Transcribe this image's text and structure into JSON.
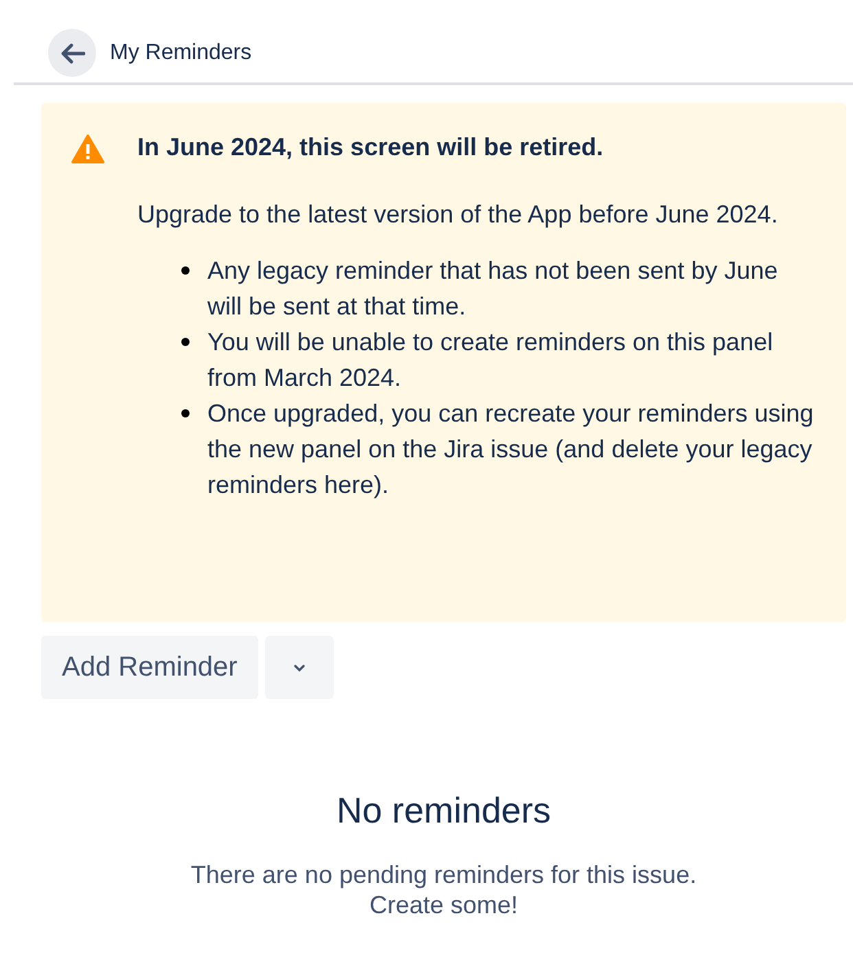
{
  "header": {
    "title": "My Reminders"
  },
  "banner": {
    "title": "In June 2024, this screen will be retired.",
    "message": "Upgrade to the latest version of the App before June 2024.",
    "bullets": [
      "Any legacy reminder that has not been sent by June will be sent at that time.",
      "You will be unable to create reminders on this panel from March 2024.",
      "Once upgraded, you can recreate your reminders using the new panel on the Jira issue (and delete your legacy reminders here)."
    ]
  },
  "actions": {
    "add_button": "Add Reminder"
  },
  "empty_state": {
    "title": "No reminders",
    "message": "There are no pending reminders for this issue. Create some!"
  }
}
